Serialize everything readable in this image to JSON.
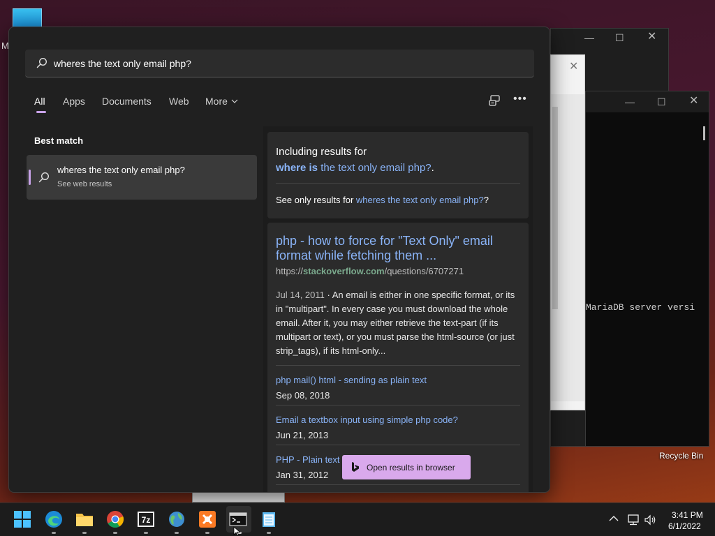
{
  "desktop": {
    "letter": "M",
    "recycle_bin": "Recycle Bin"
  },
  "console": {
    "text": "MariaDB server versi"
  },
  "search": {
    "query": "wheres the text only email php?",
    "icon": "search-icon"
  },
  "tabs": [
    {
      "label": "All"
    },
    {
      "label": "Apps"
    },
    {
      "label": "Documents"
    },
    {
      "label": "Web"
    },
    {
      "label": "More"
    }
  ],
  "best_match": {
    "heading": "Best match",
    "title": "wheres the text only email php?",
    "subtitle": "See web results"
  },
  "including": {
    "heading": "Including results for",
    "corrected_bold": "where is",
    "corrected_rest": " the text only email php?",
    "corrected_end": ".",
    "only_prefix": "See only results for ",
    "only_query": "wheres the text only email php?",
    "only_end": "?"
  },
  "result": {
    "title": "php - how to force for \"Text Only\" email format while fetching them ...",
    "url_prefix": "https://",
    "url_domain": "stackoverflow.com",
    "url_path": "/questions/6707271",
    "date": "Jul 14, 2011",
    "snippet": " · An email is either in one specific format, or its in \"multipart\". In every case you must download the whole email. After it, you may either retrieve the text-part (if its multipart or text), or you must parse the html-source (or just strip_tags), if its html-only...",
    "related": [
      {
        "title": "php mail() html - sending as plain text",
        "date": "Sep 08, 2018"
      },
      {
        "title": "Email a textbox input using simple php code?",
        "date": "Jun 21, 2013"
      },
      {
        "title": "PHP - Plain text",
        "date": "Jan 31, 2012"
      }
    ]
  },
  "open_button": {
    "label": "Open results in browser"
  },
  "clock": {
    "time": "3:41 PM",
    "date": "6/1/2022"
  },
  "colors": {
    "accent": "#c8a2e8",
    "link": "#8ab4f8",
    "open_button": "#d9a9ec"
  }
}
